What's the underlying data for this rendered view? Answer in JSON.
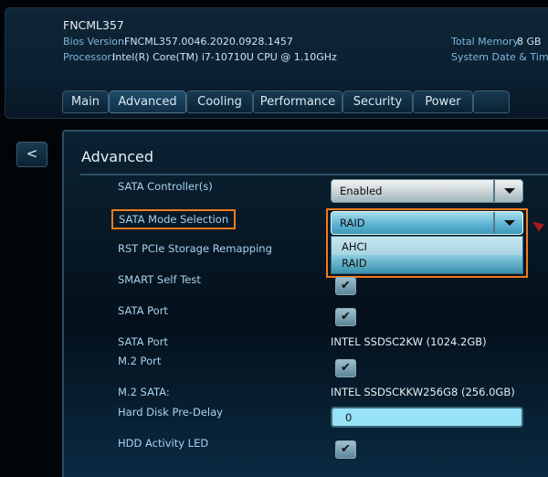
{
  "header": {
    "model": "FNCML357",
    "bios_label": "Bios Version:",
    "bios_value": "FNCML357.0046.2020.0928.1457",
    "processor_label": "Processor:",
    "processor_value": "Intel(R) Core(TM) i7-10710U CPU @ 1.10GHz",
    "memory_label": "Total Memory:",
    "memory_value": "8 GB",
    "datetime_label": "System Date & Time:"
  },
  "tabs": [
    {
      "label": "Main"
    },
    {
      "label": "Advanced",
      "active": true
    },
    {
      "label": "Cooling"
    },
    {
      "label": "Performance"
    },
    {
      "label": "Security"
    },
    {
      "label": "Power"
    }
  ],
  "back_label": "<",
  "page_title": "Advanced",
  "rows": {
    "sata_controller": {
      "label": "SATA Controller(s)",
      "value": "Enabled"
    },
    "sata_mode": {
      "label": "SATA Mode Selection",
      "value": "RAID",
      "options": [
        "AHCI",
        "RAID"
      ]
    },
    "rst_remap": {
      "label": "RST PCIe Storage Remapping"
    },
    "smart": {
      "label": "SMART Self Test",
      "checked": true
    },
    "sata_port1": {
      "label": "SATA Port",
      "checked": true
    },
    "sata_port2": {
      "label": "SATA Port",
      "value": "INTEL SSDSC2KW (1024.2GB)"
    },
    "m2_port": {
      "label": "M.2 Port",
      "checked": true
    },
    "m2_sata": {
      "label": "M.2 SATA:",
      "value": "INTEL SSDSCKKW256G8 (256.0GB)"
    },
    "hdd_delay": {
      "label": "Hard Disk Pre-Delay",
      "value": "0"
    },
    "hdd_led": {
      "label": "HDD Activity LED",
      "checked": true
    }
  },
  "check_glyph": "✔",
  "colors": {
    "highlight": "#f07a1c",
    "accent": "#5fb4d4"
  }
}
